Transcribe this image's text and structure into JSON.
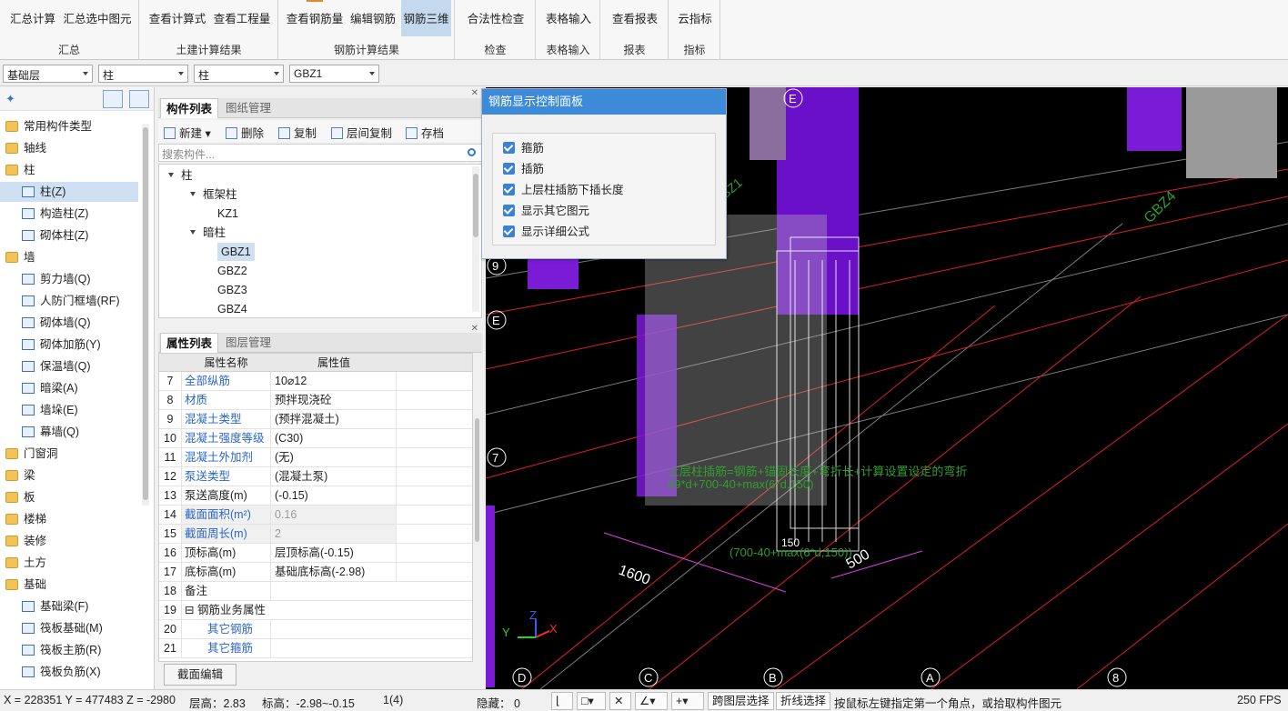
{
  "ribbon": {
    "groups": [
      {
        "label": "汇总",
        "buttons": [
          "汇总计算",
          "汇总选中图元"
        ]
      },
      {
        "label": "土建计算结果",
        "buttons": [
          "查看计算式",
          "查看工程量"
        ]
      },
      {
        "label": "钢筋计算结果",
        "buttons": [
          "查看钢筋量",
          "编辑钢筋",
          "钢筋三维"
        ]
      },
      {
        "label": "检查",
        "buttons": [
          "合法性检查"
        ]
      },
      {
        "label": "表格输入",
        "buttons": [
          "表格输入"
        ]
      },
      {
        "label": "报表",
        "buttons": [
          "查看报表"
        ]
      },
      {
        "label": "指标",
        "buttons": [
          "云指标"
        ]
      }
    ]
  },
  "selectors": {
    "floor": "基础层",
    "category": "柱",
    "type": "柱",
    "element": "GBZ1"
  },
  "nav_tree": [
    {
      "label": "常用构件类型",
      "level": 0
    },
    {
      "label": "轴线",
      "level": 0
    },
    {
      "label": "柱",
      "level": 0
    },
    {
      "label": "柱(Z)",
      "level": 1,
      "selected": true
    },
    {
      "label": "构造柱(Z)",
      "level": 1
    },
    {
      "label": "砌体柱(Z)",
      "level": 1
    },
    {
      "label": "墙",
      "level": 0
    },
    {
      "label": "剪力墙(Q)",
      "level": 1
    },
    {
      "label": "人防门框墙(RF)",
      "level": 1
    },
    {
      "label": "砌体墙(Q)",
      "level": 1
    },
    {
      "label": "砌体加筋(Y)",
      "level": 1
    },
    {
      "label": "保温墙(Q)",
      "level": 1
    },
    {
      "label": "暗梁(A)",
      "level": 1
    },
    {
      "label": "墙垛(E)",
      "level": 1
    },
    {
      "label": "幕墙(Q)",
      "level": 1
    },
    {
      "label": "门窗洞",
      "level": 0
    },
    {
      "label": "梁",
      "level": 0
    },
    {
      "label": "板",
      "level": 0
    },
    {
      "label": "楼梯",
      "level": 0
    },
    {
      "label": "装修",
      "level": 0
    },
    {
      "label": "土方",
      "level": 0
    },
    {
      "label": "基础",
      "level": 0
    },
    {
      "label": "基础梁(F)",
      "level": 1
    },
    {
      "label": "筏板基础(M)",
      "level": 1
    },
    {
      "label": "筏板主筋(R)",
      "level": 1
    },
    {
      "label": "筏板负筋(X)",
      "level": 1
    }
  ],
  "component_panel": {
    "tabs": [
      "构件列表",
      "图纸管理"
    ],
    "actions": [
      "新建",
      "删除",
      "复制",
      "层间复制",
      "存档"
    ],
    "search_placeholder": "搜索构件...",
    "tree": [
      {
        "label": "柱",
        "level": 0
      },
      {
        "label": "框架柱",
        "level": 1
      },
      {
        "label": "KZ1",
        "level": 2
      },
      {
        "label": "暗柱",
        "level": 1
      },
      {
        "label": "GBZ1",
        "level": 2,
        "selected": true
      },
      {
        "label": "GBZ2",
        "level": 2
      },
      {
        "label": "GBZ3",
        "level": 2
      },
      {
        "label": "GBZ4",
        "level": 2
      }
    ]
  },
  "property_panel": {
    "tabs": [
      "属性列表",
      "图层管理"
    ],
    "headers": [
      "属性名称",
      "属性值"
    ],
    "rows": [
      {
        "n": "7",
        "name": "全部纵筋",
        "value": "10⌀12",
        "blue": true
      },
      {
        "n": "8",
        "name": "材质",
        "value": "预拌现浇砼",
        "blue": true
      },
      {
        "n": "9",
        "name": "混凝土类型",
        "value": "(预拌混凝土)",
        "blue": true
      },
      {
        "n": "10",
        "name": "混凝土强度等级",
        "value": "(C30)",
        "blue": true
      },
      {
        "n": "11",
        "name": "混凝土外加剂",
        "value": "(无)",
        "blue": true
      },
      {
        "n": "12",
        "name": "泵送类型",
        "value": "(混凝土泵)",
        "blue": true
      },
      {
        "n": "13",
        "name": "泵送高度(m)",
        "value": "(-0.15)"
      },
      {
        "n": "14",
        "name": "截面面积(m²)",
        "value": "0.16",
        "blue": true,
        "grayval": true,
        "shade": true
      },
      {
        "n": "15",
        "name": "截面周长(m)",
        "value": "2",
        "blue": true,
        "grayval": true,
        "shade": true
      },
      {
        "n": "16",
        "name": "顶标高(m)",
        "value": "层顶标高(-0.15)"
      },
      {
        "n": "17",
        "name": "底标高(m)",
        "value": "基础底标高(-2.98)"
      },
      {
        "n": "18",
        "name": "备注",
        "value": ""
      },
      {
        "n": "19",
        "name": "钢筋业务属性",
        "value": "",
        "group": true
      },
      {
        "n": "20",
        "name": "其它钢筋",
        "value": "",
        "child": true
      },
      {
        "n": "21",
        "name": "其它箍筋",
        "value": "",
        "child": true
      }
    ],
    "edit_button": "截面编辑"
  },
  "popup": {
    "title": "钢筋显示控制面板",
    "options": [
      "箍筋",
      "插筋",
      "上层柱插筋下插长度",
      "显示其它图元",
      "显示详细公式"
    ]
  },
  "viewport": {
    "axis_labels": [
      "E",
      "9",
      "E",
      "7",
      "D",
      "C",
      "B",
      "A",
      "8"
    ],
    "dims": [
      "1600",
      "500",
      "150"
    ],
    "annot_formula1": "上层柱插筋=钢筋+锚固长度+弯折长+计算设置设定的弯折",
    "annot_formula2": "49*d+700-40+max(6*d,150)",
    "annot_formula3": "(700-40+max(6*d,150))",
    "gbz_label": "GBZ4",
    "gbz_label2": "GBZ1",
    "axis_x": "X",
    "axis_y": "Y",
    "axis_z": "Z"
  },
  "status": {
    "coords": "X = 228351 Y = 477483 Z = -2980",
    "floor_height": "层高：2.83",
    "elevation": "标高：-2.98~-0.15",
    "page": "1(4)",
    "hidden": "隐藏： 0",
    "btn_cross_layer": "跨图层选择",
    "btn_polyline": "折线选择",
    "hint": "按鼠标左键指定第一个角点，或拾取构件图元",
    "fps": "250 FPS"
  },
  "colors": {
    "accent": "#3c8ad8",
    "purple": "#7a1bd6",
    "selection": "#cfe0f3"
  }
}
